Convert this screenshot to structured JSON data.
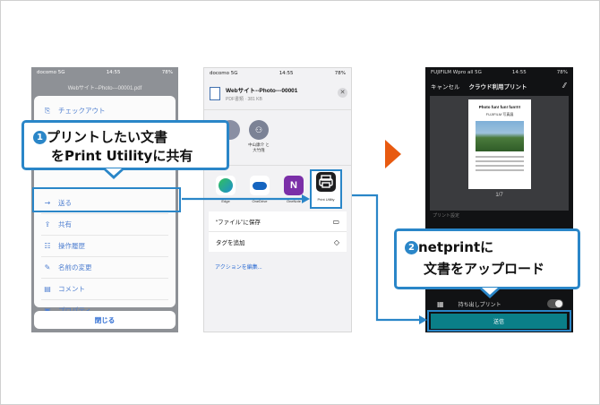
{
  "colors": {
    "accent": "#2a86c8",
    "arrow": "#e85a10",
    "send": "#0a7f88"
  },
  "phone1": {
    "status_left": "docomo 5G",
    "status_time": "14:55",
    "status_right": "78%",
    "file_title": "Webサイト--Photo---00001.pdf",
    "menu": [
      {
        "label": "チェックアウト",
        "icon": "checkout-icon"
      },
      {
        "label": "送る",
        "icon": "send-arrow-icon"
      },
      {
        "label": "共有",
        "icon": "share-icon"
      },
      {
        "label": "操作履歴",
        "icon": "history-icon"
      },
      {
        "label": "名前の変更",
        "icon": "rename-icon"
      },
      {
        "label": "コメント",
        "icon": "comment-icon"
      },
      {
        "label": "プロパティ",
        "icon": "property-icon"
      }
    ],
    "close_label": "閉じる"
  },
  "phone2": {
    "status_left": "docomo 5G",
    "status_time": "14:55",
    "status_right": "78%",
    "file_name": "Webサイト--Photo---00001",
    "file_meta": "PDF書類 · 381 KB",
    "contact_label": "中山康介 と\n大竹隆",
    "apps": [
      {
        "label": "Edge",
        "icon": "edge-icon",
        "color": "#1e8fcf"
      },
      {
        "label": "OneDrive",
        "icon": "onedrive-icon",
        "color": "#1565c0"
      },
      {
        "label": "OneNote",
        "icon": "onenote-icon",
        "color": "#7b2fa8"
      },
      {
        "label": "Print Utility",
        "icon": "printer-icon",
        "color": "#1d1d1f"
      }
    ],
    "actions": [
      {
        "label": "“ファイル”に保存",
        "icon": "folder-icon"
      },
      {
        "label": "タグを追加",
        "icon": "tag-icon"
      }
    ],
    "edit_actions": "アクションを編集..."
  },
  "phone3": {
    "status_left": "FUJIFILM Wpro all 5G",
    "status_time": "14:55",
    "status_right": "78%",
    "cancel": "キャンセル",
    "title": "クラウド利用プリント",
    "doc_heading": "Photo fun! fun! fun!!!!",
    "doc_sub": "FUJIFILM 写真展",
    "page_indicator": "1/7",
    "print_settings": "プリント設定",
    "hold_label": "持ち出しプリント",
    "send_label": "送信"
  },
  "callout1": {
    "number": "1",
    "line1": "プリントしたい文書",
    "line2": "をPrint  Utilityに共有"
  },
  "callout2": {
    "number": "2",
    "line1": "netprintに",
    "line2": "文書をアップロード"
  }
}
